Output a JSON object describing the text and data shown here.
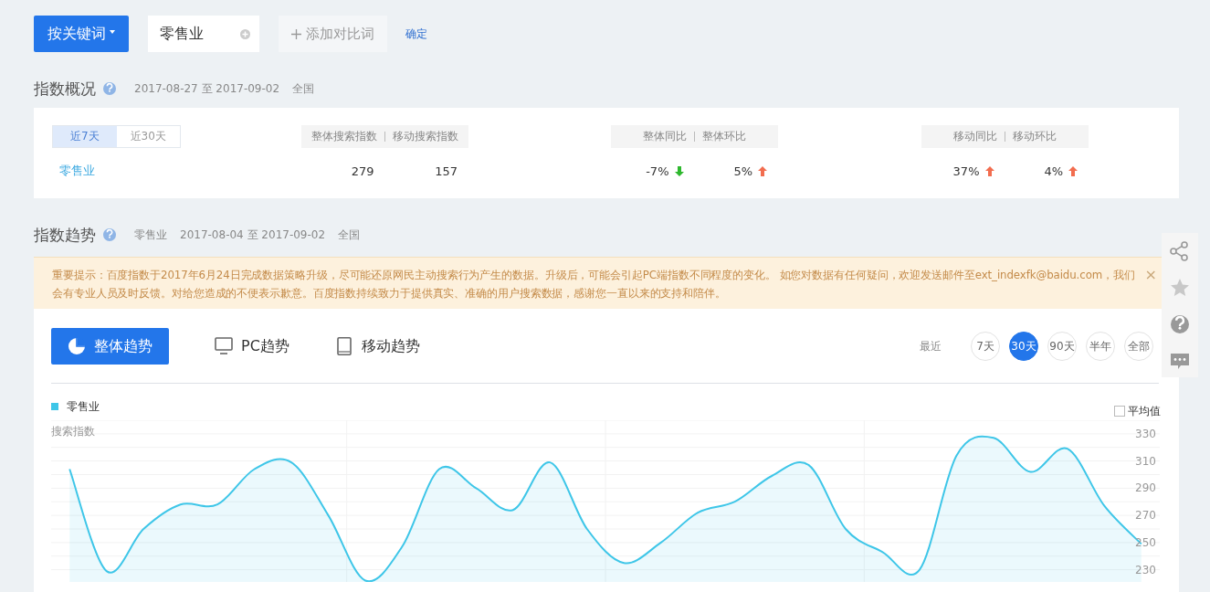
{
  "search_bar": {
    "mode_button": {
      "label": "按关键词"
    },
    "keyword_field": {
      "value": "零售业"
    },
    "add_button": {
      "label": "添加对比词"
    },
    "confirm_link": "确定"
  },
  "overview": {
    "title": "指数概况",
    "date_range": "2017-08-27 至 2017-09-02",
    "region": "全国",
    "period_tabs": [
      {
        "label": "近7天",
        "selected": true
      },
      {
        "label": "近30天",
        "selected": false
      }
    ],
    "header_groups": [
      [
        "整体搜索指数",
        "移动搜索指数"
      ],
      [
        "整体同比",
        "整体环比"
      ],
      [
        "移动同比",
        "移动环比"
      ]
    ],
    "row": {
      "keyword": "零售业",
      "groups": [
        [
          {
            "text": "279",
            "kind": "plain"
          },
          {
            "text": "157",
            "kind": "plain"
          }
        ],
        [
          {
            "text": "-7%",
            "kind": "down"
          },
          {
            "text": "5%",
            "kind": "up"
          }
        ],
        [
          {
            "text": "37%",
            "kind": "up"
          },
          {
            "text": "4%",
            "kind": "up"
          }
        ]
      ]
    }
  },
  "trend": {
    "title": "指数趋势",
    "keyword": "零售业",
    "date_range": "2017-08-04 至 2017-09-02",
    "region": "全国",
    "notice": {
      "text": "重要提示：百度指数于2017年6月24日完成数据策略升级，尽可能还原网民主动搜索行为产生的数据。升级后，可能会引起PC端指数不同程度的变化。 如您对数据有任何疑问，欢迎发送邮件至ext_indexfk@baidu.com，我们会有专业人员及时反馈。对给您造成的不便表示歉意。百度指数持续致力于提供真实、准确的用户搜索数据，感谢您一直以来的支持和陪伴。",
      "close": "×"
    },
    "view_tabs": [
      {
        "label": "整体趋势",
        "selected": true
      },
      {
        "label": "PC趋势",
        "selected": false
      },
      {
        "label": "移动趋势",
        "selected": false
      }
    ],
    "range_label": "最近",
    "range_buttons": [
      {
        "label": "7天",
        "selected": false
      },
      {
        "label": "30天",
        "selected": true
      },
      {
        "label": "90天",
        "selected": false
      },
      {
        "label": "半年",
        "selected": false
      },
      {
        "label": "全部",
        "selected": false
      }
    ],
    "average_checkbox": {
      "label": "平均值",
      "checked": false
    },
    "chart_data": {
      "type": "area",
      "ylabel": "搜索指数",
      "ylim": [
        221,
        340
      ],
      "yticks": [
        230,
        250,
        270,
        290,
        310,
        330
      ],
      "grid": true,
      "series": [
        {
          "name": "零售业",
          "color": "#3ec6e8",
          "values": [
            304,
            229,
            260,
            278,
            278,
            304,
            309,
            270,
            222,
            247,
            304,
            290,
            274,
            309,
            260,
            235,
            250,
            272,
            280,
            299,
            307,
            260,
            243,
            230,
            314,
            327,
            302,
            319,
            277,
            249
          ]
        }
      ]
    }
  }
}
